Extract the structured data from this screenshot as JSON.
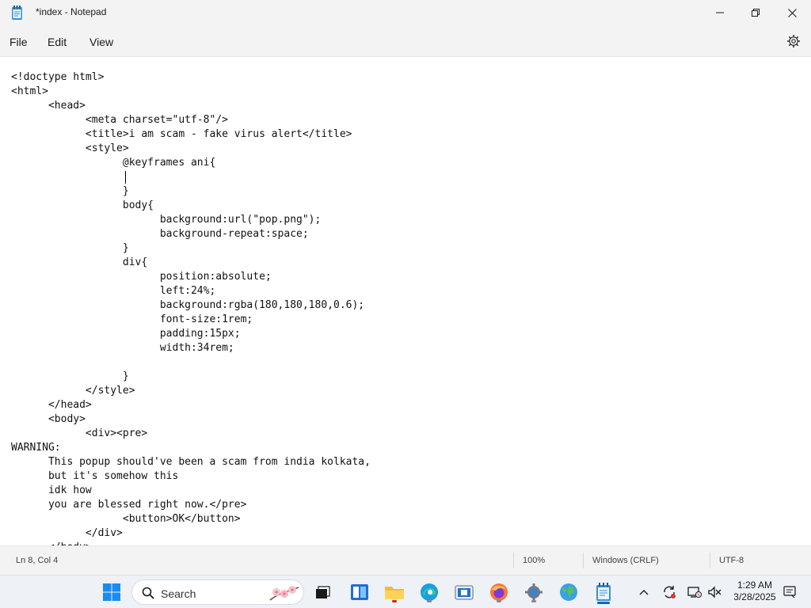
{
  "window": {
    "title": "*index - Notepad",
    "app_icon": "notepad-icon"
  },
  "menu": {
    "file": "File",
    "edit": "Edit",
    "view": "View"
  },
  "editor": {
    "lines": [
      "<!doctype html>",
      "<html>",
      "      <head>",
      "            <meta charset=\"utf-8\"/>",
      "            <title>i am scam - fake virus alert</title>",
      "            <style>",
      "                  @keyframes ani{",
      "                  ",
      "                  }",
      "                  body{",
      "                        background:url(\"pop.png\");",
      "                        background-repeat:space;",
      "                  }",
      "                  div{",
      "                        position:absolute;",
      "                        left:24%;",
      "                        background:rgba(180,180,180,0.6);",
      "                        font-size:1rem;",
      "                        padding:15px;",
      "                        width:34rem;",
      "",
      "                  }",
      "            </style>",
      "      </head>",
      "      <body>",
      "            <div><pre>",
      "WARNING:",
      "      This popup should've been a scam from india kolkata,",
      "      but it's somehow this",
      "      idk how",
      "      you are blessed right now.</pre>",
      "                  <button>OK</button>",
      "            </div>",
      "      </body>"
    ]
  },
  "status": {
    "position": "Ln 8, Col 4",
    "zoom": "100%",
    "line_ending": "Windows (CRLF)",
    "encoding": "UTF-8"
  },
  "taskbar": {
    "search_placeholder": "Search",
    "clock_time": "1:29 AM",
    "clock_date": "3/28/2025"
  },
  "colors": {
    "accent": "#0067c0",
    "chrome": "#f3f3f3"
  }
}
